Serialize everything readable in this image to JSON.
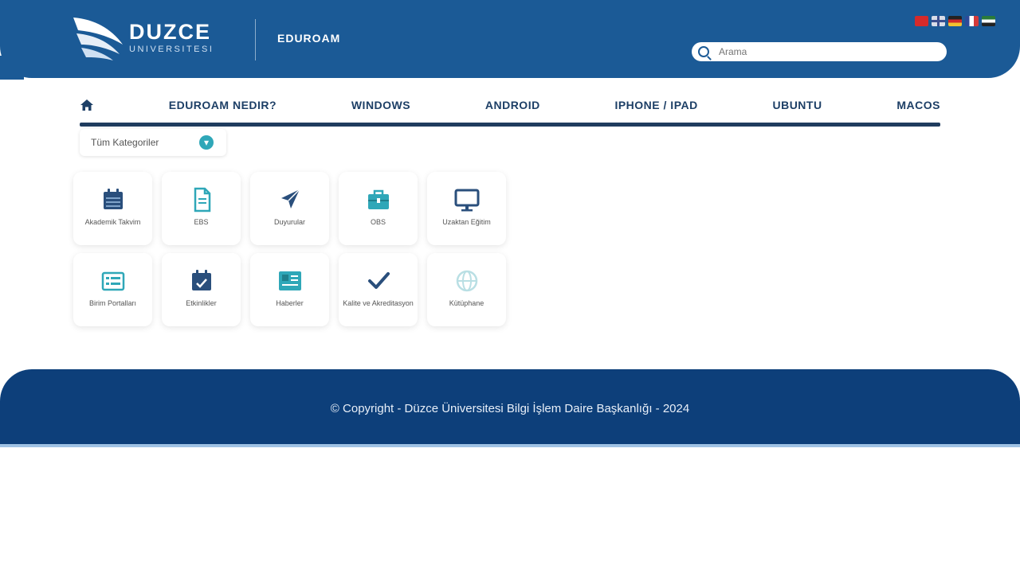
{
  "header": {
    "logo_main": "DUZCE",
    "logo_sub": "UNIVERSITESI",
    "site_name": "EDUROAM",
    "search_placeholder": "Arama",
    "flags": [
      "turkish-flag",
      "english-flag",
      "german-flag",
      "french-flag",
      "arabic-flag"
    ]
  },
  "nav": {
    "items": [
      {
        "label": "EDUROAM NEDIR?"
      },
      {
        "label": "WINDOWS"
      },
      {
        "label": "ANDROID"
      },
      {
        "label": "IPHONE / IPAD"
      },
      {
        "label": "UBUNTU"
      },
      {
        "label": "MACOS"
      }
    ]
  },
  "category": {
    "label": "Tüm Kategoriler"
  },
  "tiles": [
    {
      "label": "Akademik Takvim",
      "icon": "calendar-icon"
    },
    {
      "label": "EBS",
      "icon": "document-icon"
    },
    {
      "label": "Duyurular",
      "icon": "rocket-icon"
    },
    {
      "label": "OBS",
      "icon": "briefcase-icon"
    },
    {
      "label": "Uzaktan Eğitim",
      "icon": "monitor-icon"
    },
    {
      "label": "Birim Portalları",
      "icon": "list-icon"
    },
    {
      "label": "Etkinlikler",
      "icon": "event-calendar-icon"
    },
    {
      "label": "Haberler",
      "icon": "news-icon"
    },
    {
      "label": "Kalite ve Akreditasyon",
      "icon": "check-icon"
    },
    {
      "label": "Kütüphane",
      "icon": "globe-icon"
    }
  ],
  "footer": {
    "text": "© Copyright - Düzce Üniversitesi Bilgi İşlem Daire Başkanlığı - 2024"
  },
  "colors": {
    "header_bg": "#1b5a96",
    "footer_bg": "#0d3f7a",
    "nav_text": "#1d3f66",
    "accent_teal": "#2fa7b8",
    "icon_navy": "#2a4f7c"
  }
}
